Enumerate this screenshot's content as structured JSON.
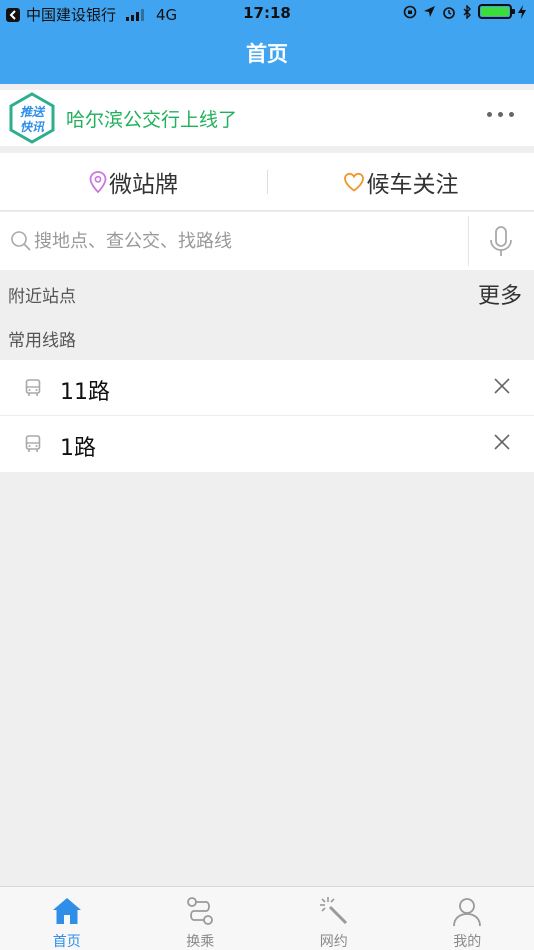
{
  "status_bar": {
    "carrier": "中国建设银行",
    "network": "4G",
    "time": "17:18"
  },
  "nav": {
    "title": "首页"
  },
  "banner": {
    "logo_text_top": "推送",
    "logo_text_bottom": "快讯",
    "text": "哈尔滨公交行上线了"
  },
  "segmented": {
    "left_label": "微站牌",
    "right_label": "候车关注"
  },
  "search": {
    "placeholder": "搜地点、查公交、找路线"
  },
  "nearby": {
    "label": "附近站点",
    "more_label": "更多"
  },
  "common": {
    "label": "常用线路"
  },
  "routes": [
    {
      "name": "11路"
    },
    {
      "name": "1路"
    }
  ],
  "tabs": [
    {
      "label": "首页",
      "icon": "home-icon",
      "active": true
    },
    {
      "label": "换乘",
      "icon": "transfer-icon",
      "active": false
    },
    {
      "label": "网约",
      "icon": "magic-wand-icon",
      "active": false
    },
    {
      "label": "我的",
      "icon": "user-icon",
      "active": false
    }
  ],
  "colors": {
    "primary": "#40a4f0",
    "banner_text": "#21b05c",
    "tab_active": "#2f8fe8"
  }
}
